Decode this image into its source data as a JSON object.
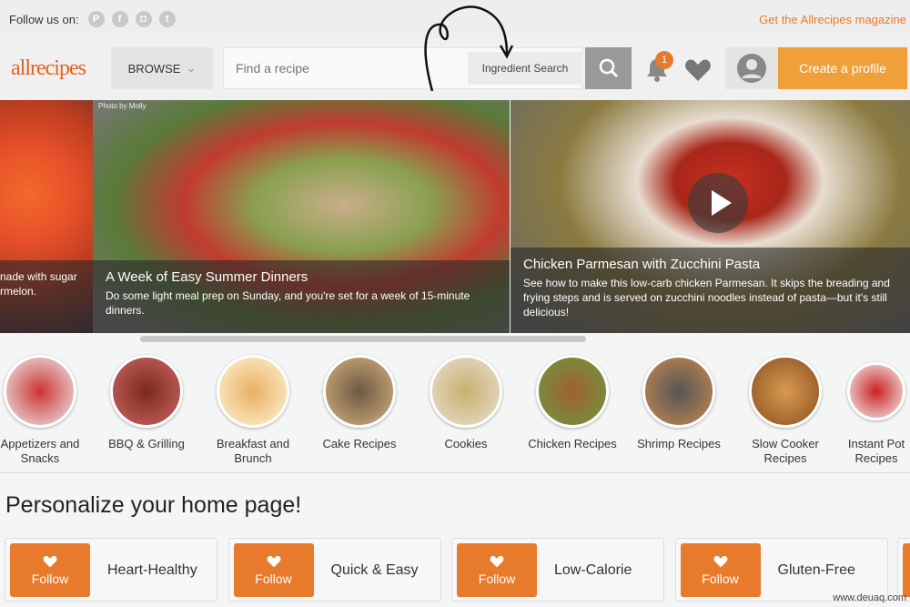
{
  "topbar": {
    "follow_label": "Follow us on:",
    "social": [
      "pinterest-icon",
      "facebook-icon",
      "instagram-icon",
      "twitter-icon"
    ],
    "app_link": "Get the Allrecipes magazine"
  },
  "header": {
    "logo": "allrecipes",
    "browse": "BROWSE",
    "search_placeholder": "Find a recipe",
    "ingredient_search": "Ingredient Search",
    "notification_count": "1",
    "create_profile": "Create a profile"
  },
  "carousel": {
    "slides": [
      {
        "title": "",
        "desc": "nade with sugar rmelon."
      },
      {
        "credit": "Photo by Molly",
        "title": "A Week of Easy Summer Dinners",
        "desc": "Do some light meal prep on Sunday, and you're set for a week of 15-minute dinners."
      },
      {
        "title": "Chicken Parmesan with Zucchini Pasta",
        "desc": "See how to make this low-carb chicken Parmesan. It skips the breading and frying steps and is served on zucchini noodles instead of pasta—but it's still delicious!",
        "video": true
      }
    ]
  },
  "categories": [
    "Appetizers and Snacks",
    "BBQ & Grilling",
    "Breakfast and Brunch",
    "Cake Recipes",
    "Cookies",
    "Chicken Recipes",
    "Shrimp Recipes",
    "Slow Cooker Recipes",
    "Instant Pot Recipes"
  ],
  "personalize": {
    "title": "Personalize your home page!",
    "follow_label": "Follow",
    "items": [
      "Heart-Healthy",
      "Quick & Easy",
      "Low-Calorie",
      "Gluten-Free"
    ]
  },
  "watermark": "www.deuaq.com",
  "colors": {
    "accent": "#e87a2c",
    "create_button": "#efa03b"
  }
}
